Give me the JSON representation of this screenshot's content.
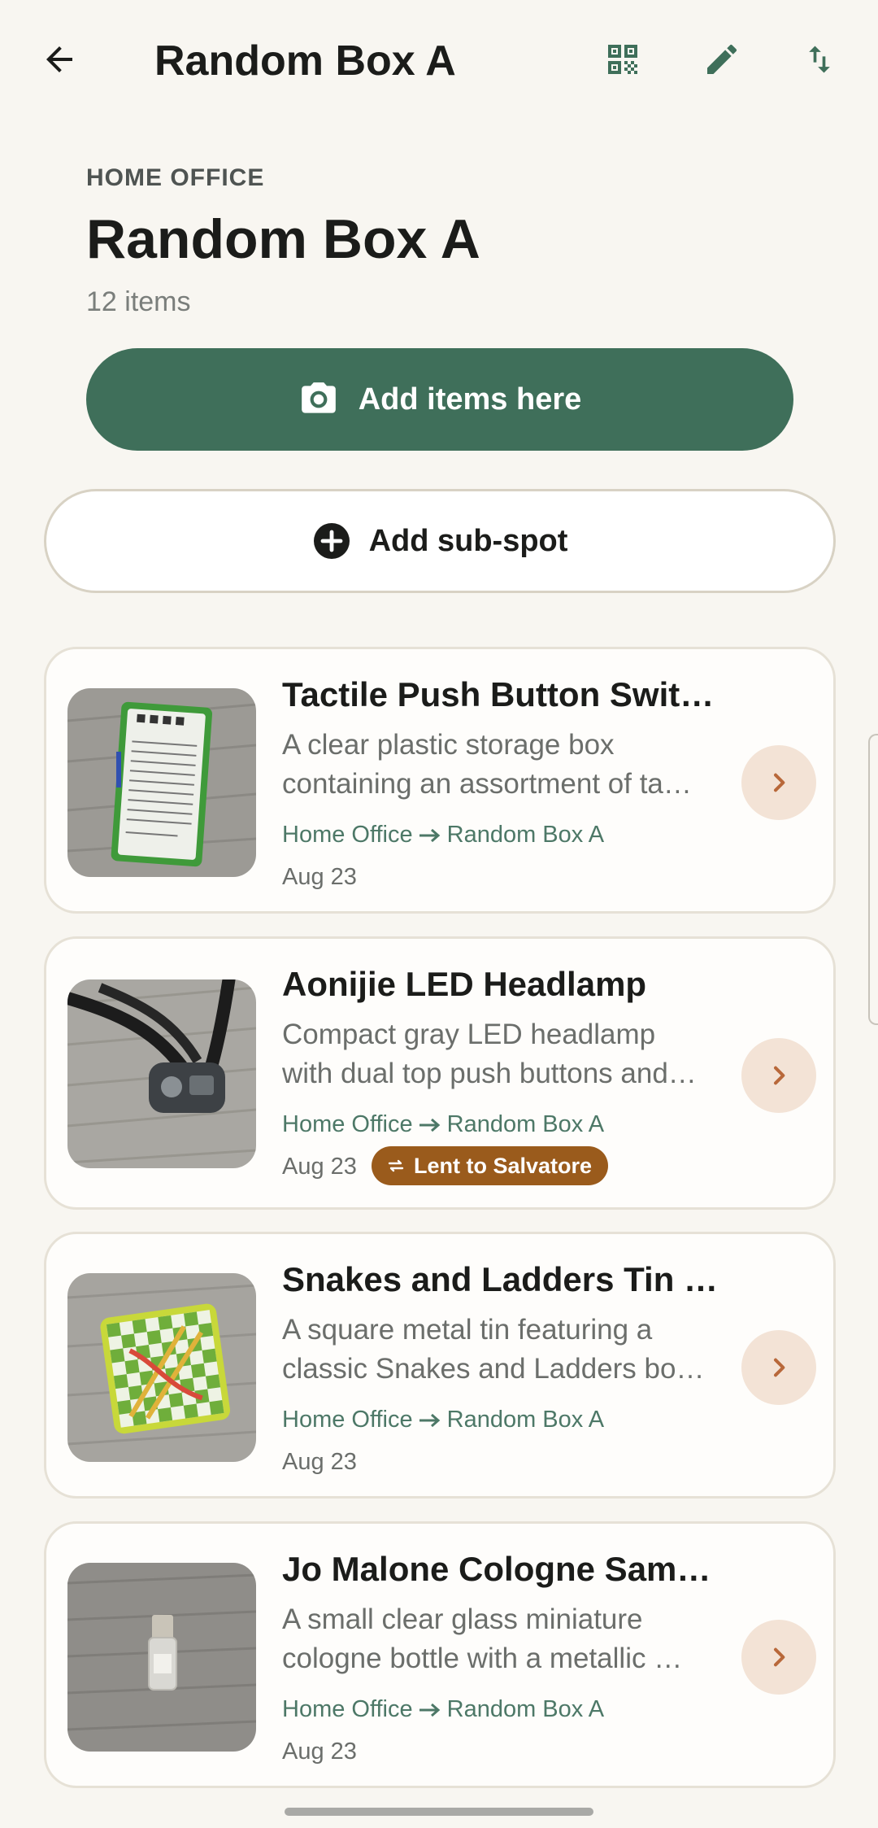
{
  "topbar": {
    "title": "Random Box A",
    "icons": [
      "arrow-back-icon",
      "qr-code-icon",
      "edit-pencil-icon",
      "sort-arrows-icon"
    ]
  },
  "header": {
    "location_label": "HOME OFFICE",
    "title": "Random Box A",
    "item_count": "12 items"
  },
  "actions": {
    "add_items_label": "Add items here",
    "add_subspot_label": "Add sub-spot"
  },
  "colors": {
    "primary": "#3f6f5a",
    "accent_badge": "#9a5b1c",
    "chevron_bg": "#f3e3d6",
    "path_text": "#4d7867",
    "background": "#f8f6f1"
  },
  "items": [
    {
      "title": "Tactile Push Button Swit…",
      "desc_line1": "A clear plastic storage box",
      "desc_line2": "containing an assortment of ta…",
      "path_from": "Home Office",
      "path_to": "Random Box A",
      "date": "Aug 23"
    },
    {
      "title": "Aonijie LED Headlamp",
      "desc_line1": "Compact gray LED headlamp",
      "desc_line2": "with dual top push buttons and…",
      "path_from": "Home Office",
      "path_to": "Random Box A",
      "date": "Aug 23",
      "badge": "Lent to Salvatore"
    },
    {
      "title": "Snakes and Ladders Tin …",
      "desc_line1": "A square metal tin featuring a",
      "desc_line2": "classic Snakes and Ladders bo…",
      "path_from": "Home Office",
      "path_to": "Random Box A",
      "date": "Aug 23"
    },
    {
      "title": "Jo Malone Cologne Sam…",
      "desc_line1": "A small clear glass miniature",
      "desc_line2": "cologne bottle with a metallic …",
      "path_from": "Home Office",
      "path_to": "Random Box A",
      "date": "Aug 23"
    }
  ]
}
